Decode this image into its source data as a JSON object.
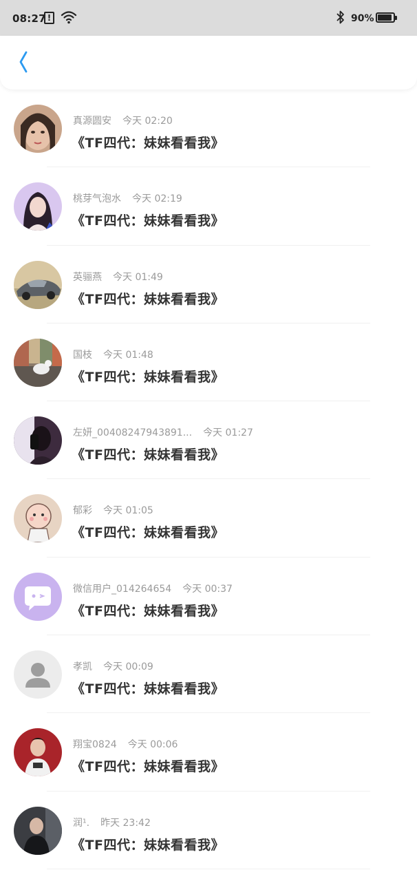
{
  "status_bar": {
    "time": "08:27",
    "alert_glyph": "!",
    "battery_text": "90%",
    "battery_level": 0.9,
    "icons": [
      "alert-icon",
      "wifi-icon",
      "bluetooth-icon",
      "battery-icon"
    ]
  },
  "nav": {
    "back_icon": "chevron-left-icon",
    "accent_color": "#2c9af0"
  },
  "items": [
    {
      "name": "真源圆安",
      "time": "今天 02:20",
      "message": "《TF四代：妹妹看看我》",
      "avatar": "photo-girl"
    },
    {
      "name": "桃芽气泡水",
      "time": "今天 02:19",
      "message": "《TF四代：妹妹看看我》",
      "avatar": "photo-girl-purple"
    },
    {
      "name": "英骊燕",
      "time": "今天 01:49",
      "message": "《TF四代：妹妹看看我》",
      "avatar": "photo-car"
    },
    {
      "name": "国枝",
      "time": "今天 01:48",
      "message": "《TF四代：妹妹看看我》",
      "avatar": "photo-seagull"
    },
    {
      "name": "左妍_00408247943891...",
      "time": "今天 01:27",
      "message": "《TF四代：妹妹看看我》",
      "avatar": "photo-dark-girl"
    },
    {
      "name": "郁彩",
      "time": "今天 01:05",
      "message": "《TF四代：妹妹看看我》",
      "avatar": "cartoon-baby"
    },
    {
      "name": "微信用户_014264654",
      "time": "今天 00:37",
      "message": "《TF四代：妹妹看看我》",
      "avatar": "chat-bubble-icon"
    },
    {
      "name": "孝凯",
      "time": "今天 00:09",
      "message": "《TF四代：妹妹看看我》",
      "avatar": "default-user-icon"
    },
    {
      "name": "翔宝0824",
      "time": "今天 00:06",
      "message": "《TF四代：妹妹看看我》",
      "avatar": "photo-boy-red"
    },
    {
      "name": "润¹.",
      "time": "昨天 23:42",
      "message": "《TF四代：妹妹看看我》",
      "avatar": "photo-boy-dark"
    }
  ]
}
